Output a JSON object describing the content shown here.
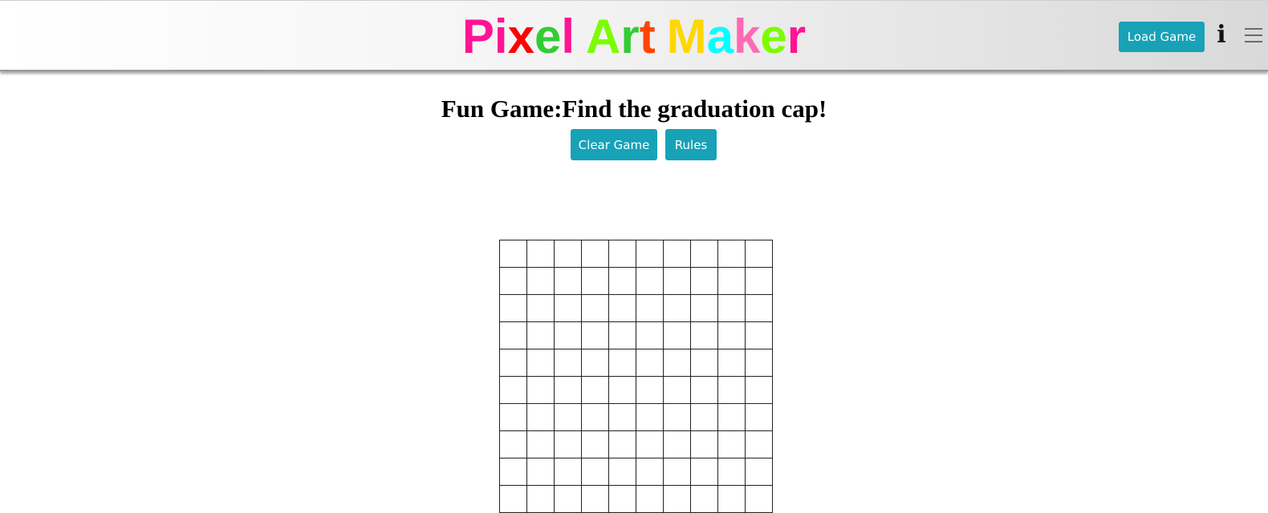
{
  "header": {
    "title_letters": [
      {
        "ch": "P",
        "color": "#ff1493"
      },
      {
        "ch": "i",
        "color": "#ff1493"
      },
      {
        "ch": "x",
        "color": "#ff0000"
      },
      {
        "ch": "e",
        "color": "#32cd32"
      },
      {
        "ch": "l",
        "color": "#ff1493"
      },
      {
        "ch": " ",
        "color": "#000000"
      },
      {
        "ch": "A",
        "color": "#7cfc00"
      },
      {
        "ch": "r",
        "color": "#32cd32"
      },
      {
        "ch": "t",
        "color": "#ff4500"
      },
      {
        "ch": " ",
        "color": "#000000"
      },
      {
        "ch": "M",
        "color": "#ffd700"
      },
      {
        "ch": "a",
        "color": "#00ffff"
      },
      {
        "ch": "k",
        "color": "#ff69b4"
      },
      {
        "ch": "e",
        "color": "#7cfc00"
      },
      {
        "ch": "r",
        "color": "#ff1493"
      }
    ],
    "load_button_label": "Load Game",
    "info_icon": "info-icon",
    "menu_icon": "hamburger-menu-icon"
  },
  "game": {
    "heading": "Fun Game:Find the graduation cap!",
    "clear_button_label": "Clear Game",
    "rules_button_label": "Rules"
  },
  "grid": {
    "columns": 10,
    "visible_rows": 10
  },
  "colors": {
    "button": "#17a2b8",
    "grid_line": "#222222"
  }
}
